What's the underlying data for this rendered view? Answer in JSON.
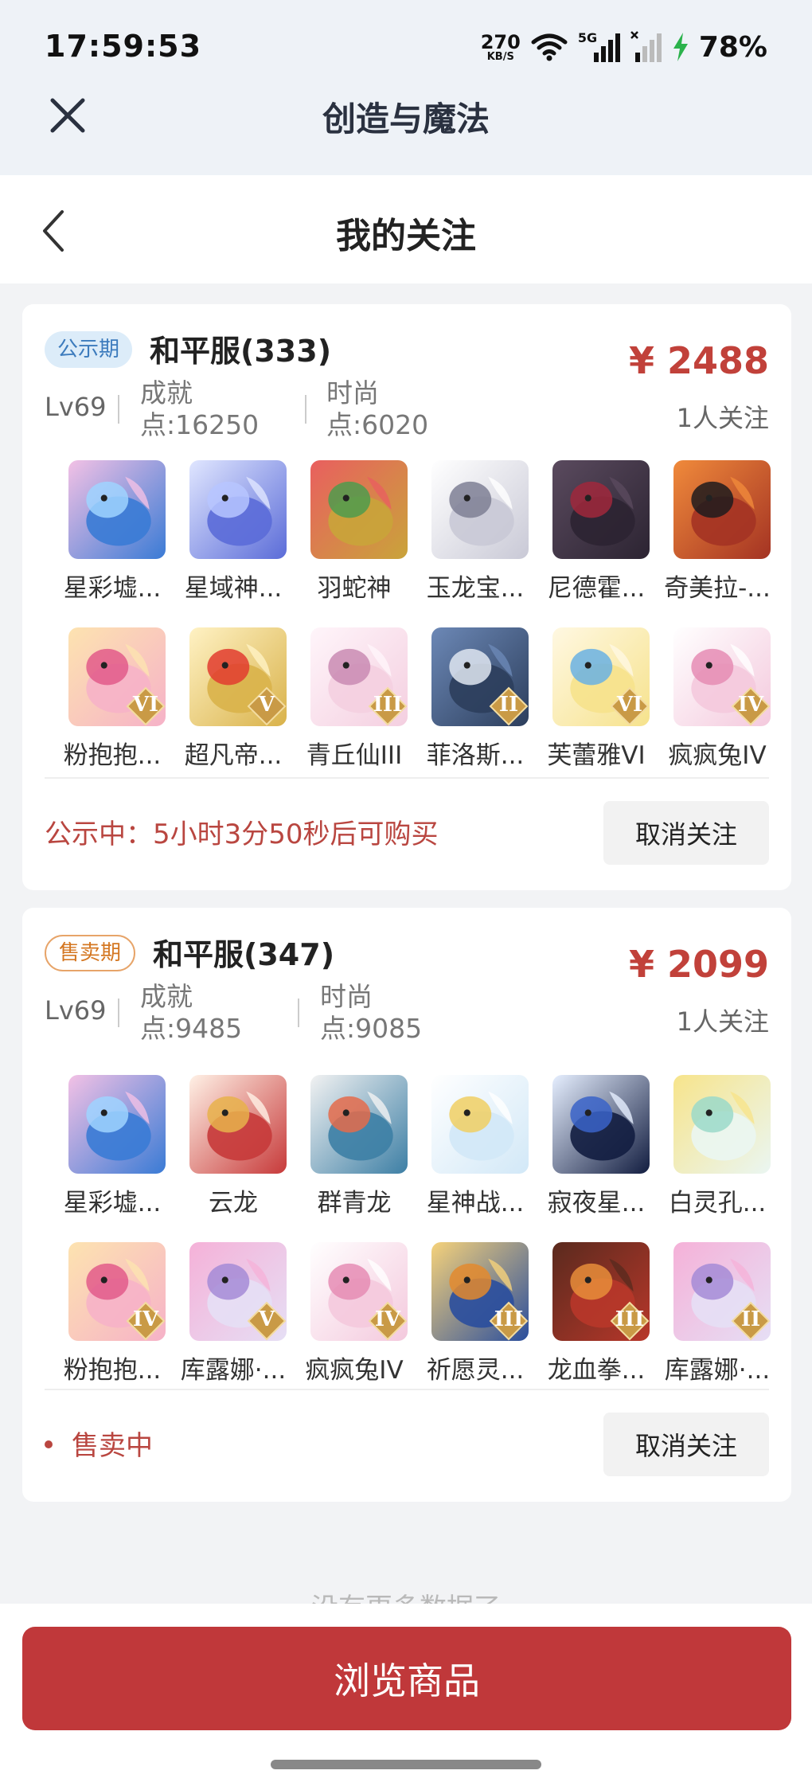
{
  "status_bar": {
    "time": "17:59:53",
    "net_speed": "270",
    "net_unit": "KB/S",
    "network": "5G",
    "battery": "78%"
  },
  "app_header": {
    "title": "创造与魔法",
    "close_icon": "close-icon"
  },
  "page_header": {
    "title": "我的关注",
    "back_icon": "chevron-left-icon"
  },
  "listings": [
    {
      "badge": "公示期",
      "server": "和平服(333)",
      "price": "¥ 2488",
      "followers": "1人关注",
      "level": "Lv69",
      "achievement_label": "成就",
      "achievement_value": "点:16250",
      "fashion_label": "时尚",
      "fashion_value": "点:6020",
      "pets": [
        {
          "name": "星彩墟...",
          "tier": ""
        },
        {
          "name": "星域神...",
          "tier": ""
        },
        {
          "name": "羽蛇神",
          "tier": ""
        },
        {
          "name": "玉龙宝...",
          "tier": ""
        },
        {
          "name": "尼德霍...",
          "tier": ""
        },
        {
          "name": "奇美拉-...",
          "tier": ""
        },
        {
          "name": "粉抱抱...",
          "tier": "VI"
        },
        {
          "name": "超凡帝...",
          "tier": "V"
        },
        {
          "name": "青丘仙III",
          "tier": "III"
        },
        {
          "name": "菲洛斯...",
          "tier": "II"
        },
        {
          "name": "芙蕾雅VI",
          "tier": "VI"
        },
        {
          "name": "疯疯兔IV",
          "tier": "IV"
        }
      ],
      "status": "公示中：5小时3分50秒后可购买",
      "action": "取消关注"
    },
    {
      "badge": "售卖期",
      "server": "和平服(347)",
      "price": "¥ 2099",
      "followers": "1人关注",
      "level": "Lv69",
      "achievement_label": "成就",
      "achievement_value": "点:9485",
      "fashion_label": "时尚",
      "fashion_value": "点:9085",
      "pets": [
        {
          "name": "星彩墟...",
          "tier": ""
        },
        {
          "name": "云龙",
          "tier": ""
        },
        {
          "name": "群青龙",
          "tier": ""
        },
        {
          "name": "星神战...",
          "tier": ""
        },
        {
          "name": "寂夜星...",
          "tier": ""
        },
        {
          "name": "白灵孔...",
          "tier": ""
        },
        {
          "name": "粉抱抱...",
          "tier": "IV"
        },
        {
          "name": "库露娜·...",
          "tier": "V"
        },
        {
          "name": "疯疯兔IV",
          "tier": "IV"
        },
        {
          "name": "祈愿灵...",
          "tier": "III"
        },
        {
          "name": "龙血拳...",
          "tier": "III"
        },
        {
          "name": "库露娜·...",
          "tier": "II"
        }
      ],
      "status": "售卖中",
      "action": "取消关注"
    }
  ],
  "footer": {
    "no_more": "没有更多数据了",
    "browse_button": "浏览商品"
  },
  "colors": {
    "accent": "#c0383a",
    "price": "#c1413a",
    "badge_blue": "#3c7bbd",
    "badge_orange": "#d47722"
  }
}
